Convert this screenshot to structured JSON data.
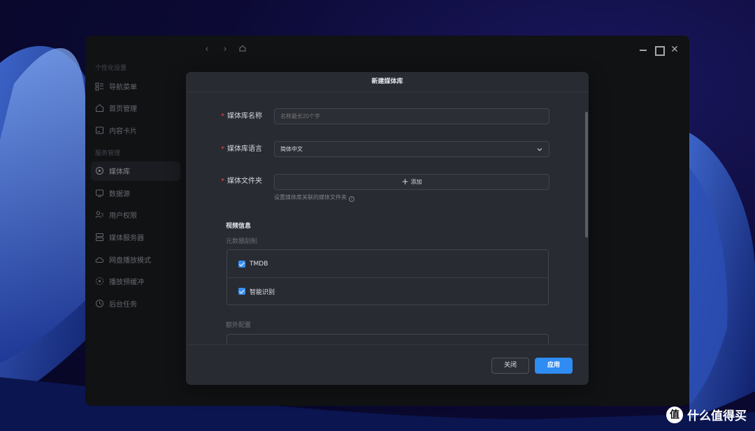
{
  "sidebar": {
    "group1": "个性化设置",
    "group2": "服务管理",
    "items": [
      {
        "label": "导航菜单",
        "icon": "menu-list-icon"
      },
      {
        "label": "首页管理",
        "icon": "home-icon"
      },
      {
        "label": "内容卡片",
        "icon": "card-icon"
      },
      {
        "label": "媒体库",
        "icon": "media-library-icon",
        "active": true
      },
      {
        "label": "数据源",
        "icon": "data-source-icon"
      },
      {
        "label": "用户权限",
        "icon": "user-permission-icon"
      },
      {
        "label": "媒体服务器",
        "icon": "server-icon"
      },
      {
        "label": "网盘播放模式",
        "icon": "cloud-play-icon"
      },
      {
        "label": "播放预缓冲",
        "icon": "buffer-icon"
      },
      {
        "label": "后台任务",
        "icon": "clock-icon"
      }
    ]
  },
  "dialog": {
    "title": "新建媒体库",
    "fields": {
      "name": {
        "label": "媒体库名称",
        "placeholder": "名称最长20个字"
      },
      "language": {
        "label": "媒体库语言",
        "value": "简体中文"
      },
      "folder": {
        "label": "媒体文件夹",
        "button": "添加",
        "hint": "设置媒体库关联的媒体文件夹"
      }
    },
    "video_section": "视频信息",
    "metadata_label": "元数据刮削",
    "metadata_options": [
      {
        "label": "TMDB",
        "checked": true
      },
      {
        "label": "智能识别",
        "checked": true
      }
    ],
    "extra_label": "额外配置",
    "cancel": "关闭",
    "apply": "应用"
  },
  "watermark": {
    "logo": "值",
    "text": "什么值得买"
  },
  "colors": {
    "accent": "#2f8cf2",
    "required": "#e5484d",
    "dialog_bg": "#282b32",
    "window_bg": "#17191d"
  }
}
